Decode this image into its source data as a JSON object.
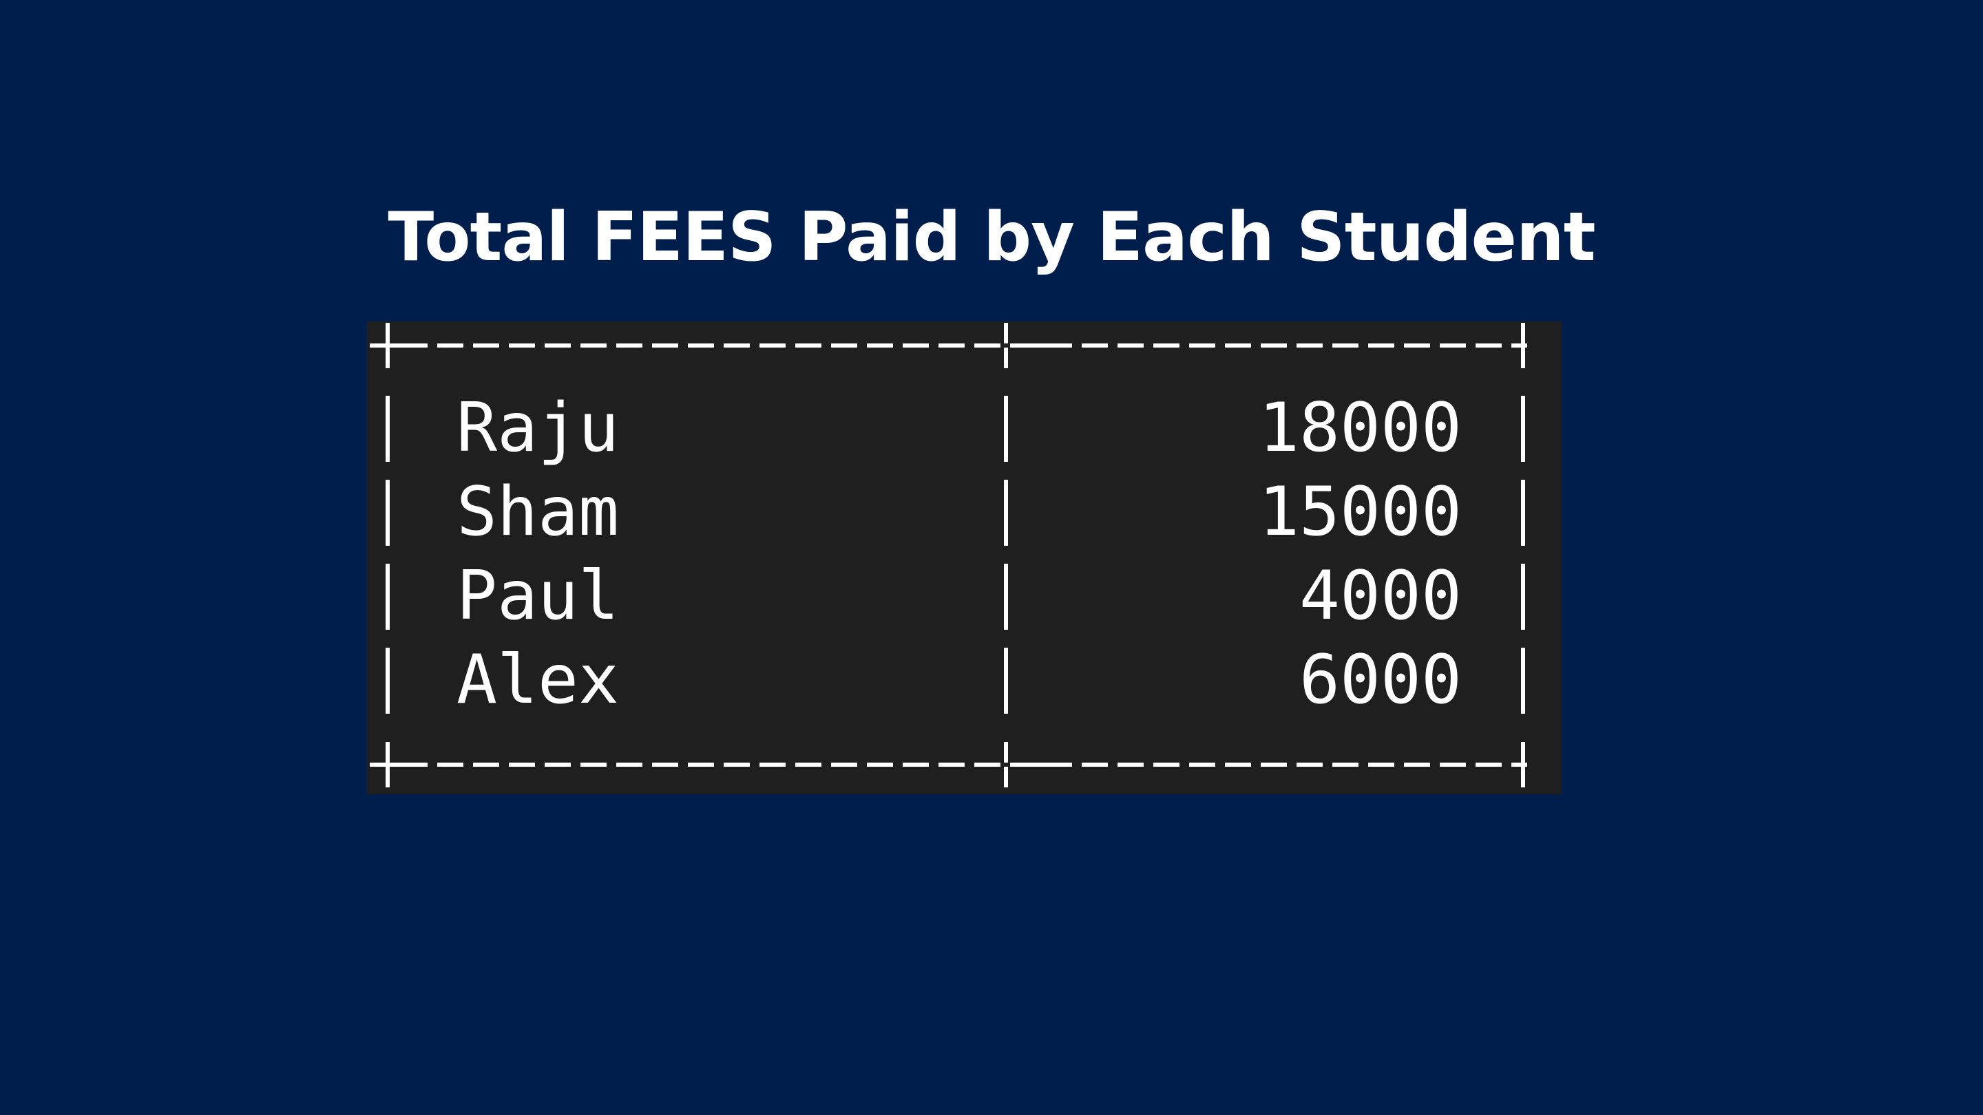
{
  "title": "Total FEES Paid by Each Student",
  "table": {
    "rows": [
      {
        "name": "Raju",
        "fees": "18000"
      },
      {
        "name": "Sham",
        "fees": "15000"
      },
      {
        "name": "Paul",
        "fees": "4000"
      },
      {
        "name": "Alex",
        "fees": "6000"
      }
    ]
  },
  "colors": {
    "background": "#001e4c",
    "terminal_background": "#1f1f1f",
    "text": "#ffffff"
  }
}
